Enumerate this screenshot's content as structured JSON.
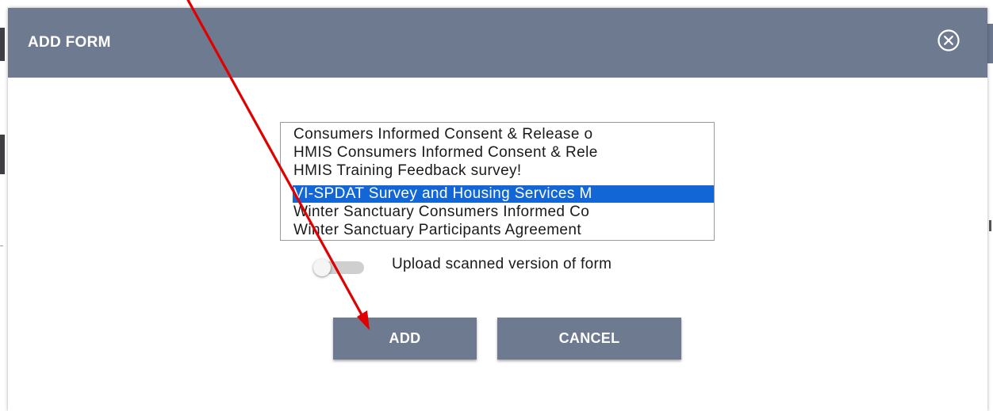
{
  "dialog": {
    "title": "ADD FORM",
    "close_icon": "close-circle-icon"
  },
  "form_list": {
    "items": [
      {
        "label": "Consumers Informed Consent & Release o",
        "selected": false
      },
      {
        "label": "HMIS Consumers Informed Consent & Rele",
        "selected": false
      },
      {
        "label": "HMIS Training Feedback survey!",
        "selected": false
      },
      {
        "label": "VI-SPDAT Survey and Housing Services M",
        "selected": true
      },
      {
        "label": "Winter Sanctuary Consumers Informed Co",
        "selected": false
      },
      {
        "label": "Winter Sanctuary Participants Agreement",
        "selected": false
      }
    ],
    "selection_color": "#1366d6"
  },
  "upload_toggle": {
    "label": "Upload scanned version of form",
    "checked": false
  },
  "actions": {
    "add_label": "ADD",
    "cancel_label": "CANCEL"
  },
  "colors": {
    "header_bg": "#6d7a90",
    "button_bg": "#6d7a90",
    "annotation_arrow": "#e00000"
  }
}
